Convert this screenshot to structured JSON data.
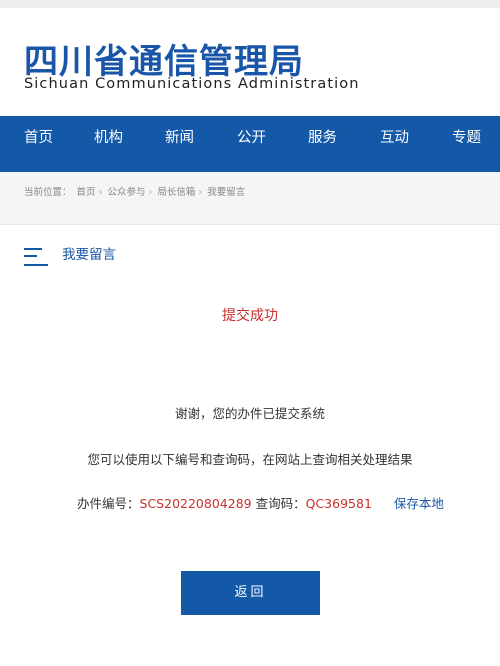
{
  "header": {
    "title_cn": "四川省通信管理局",
    "title_en": "Sichuan Communications Administration"
  },
  "nav": {
    "items": [
      "首页",
      "机构",
      "新闻",
      "公开",
      "服务",
      "互动",
      "专题"
    ]
  },
  "breadcrumb": {
    "prefix": "当前位置：",
    "items": [
      "首页",
      "公众参与",
      "局长信箱",
      "我要留言"
    ],
    "separator": "›"
  },
  "panel": {
    "title": "我要留言"
  },
  "result": {
    "status": "提交成功",
    "thanks": "谢谢，您的办件已提交系统",
    "hint": "您可以使用以下编号和查询码，在网站上查询相关处理结果",
    "case_label": "办件编号：",
    "case_number": "SCS20220804289",
    "query_label": "查询码：",
    "query_code": "QC369581",
    "save_label": "保存本地"
  },
  "actions": {
    "back_label": "返回"
  },
  "colors": {
    "brand_blue": "#1459a8",
    "alert_red": "#c9302c"
  }
}
